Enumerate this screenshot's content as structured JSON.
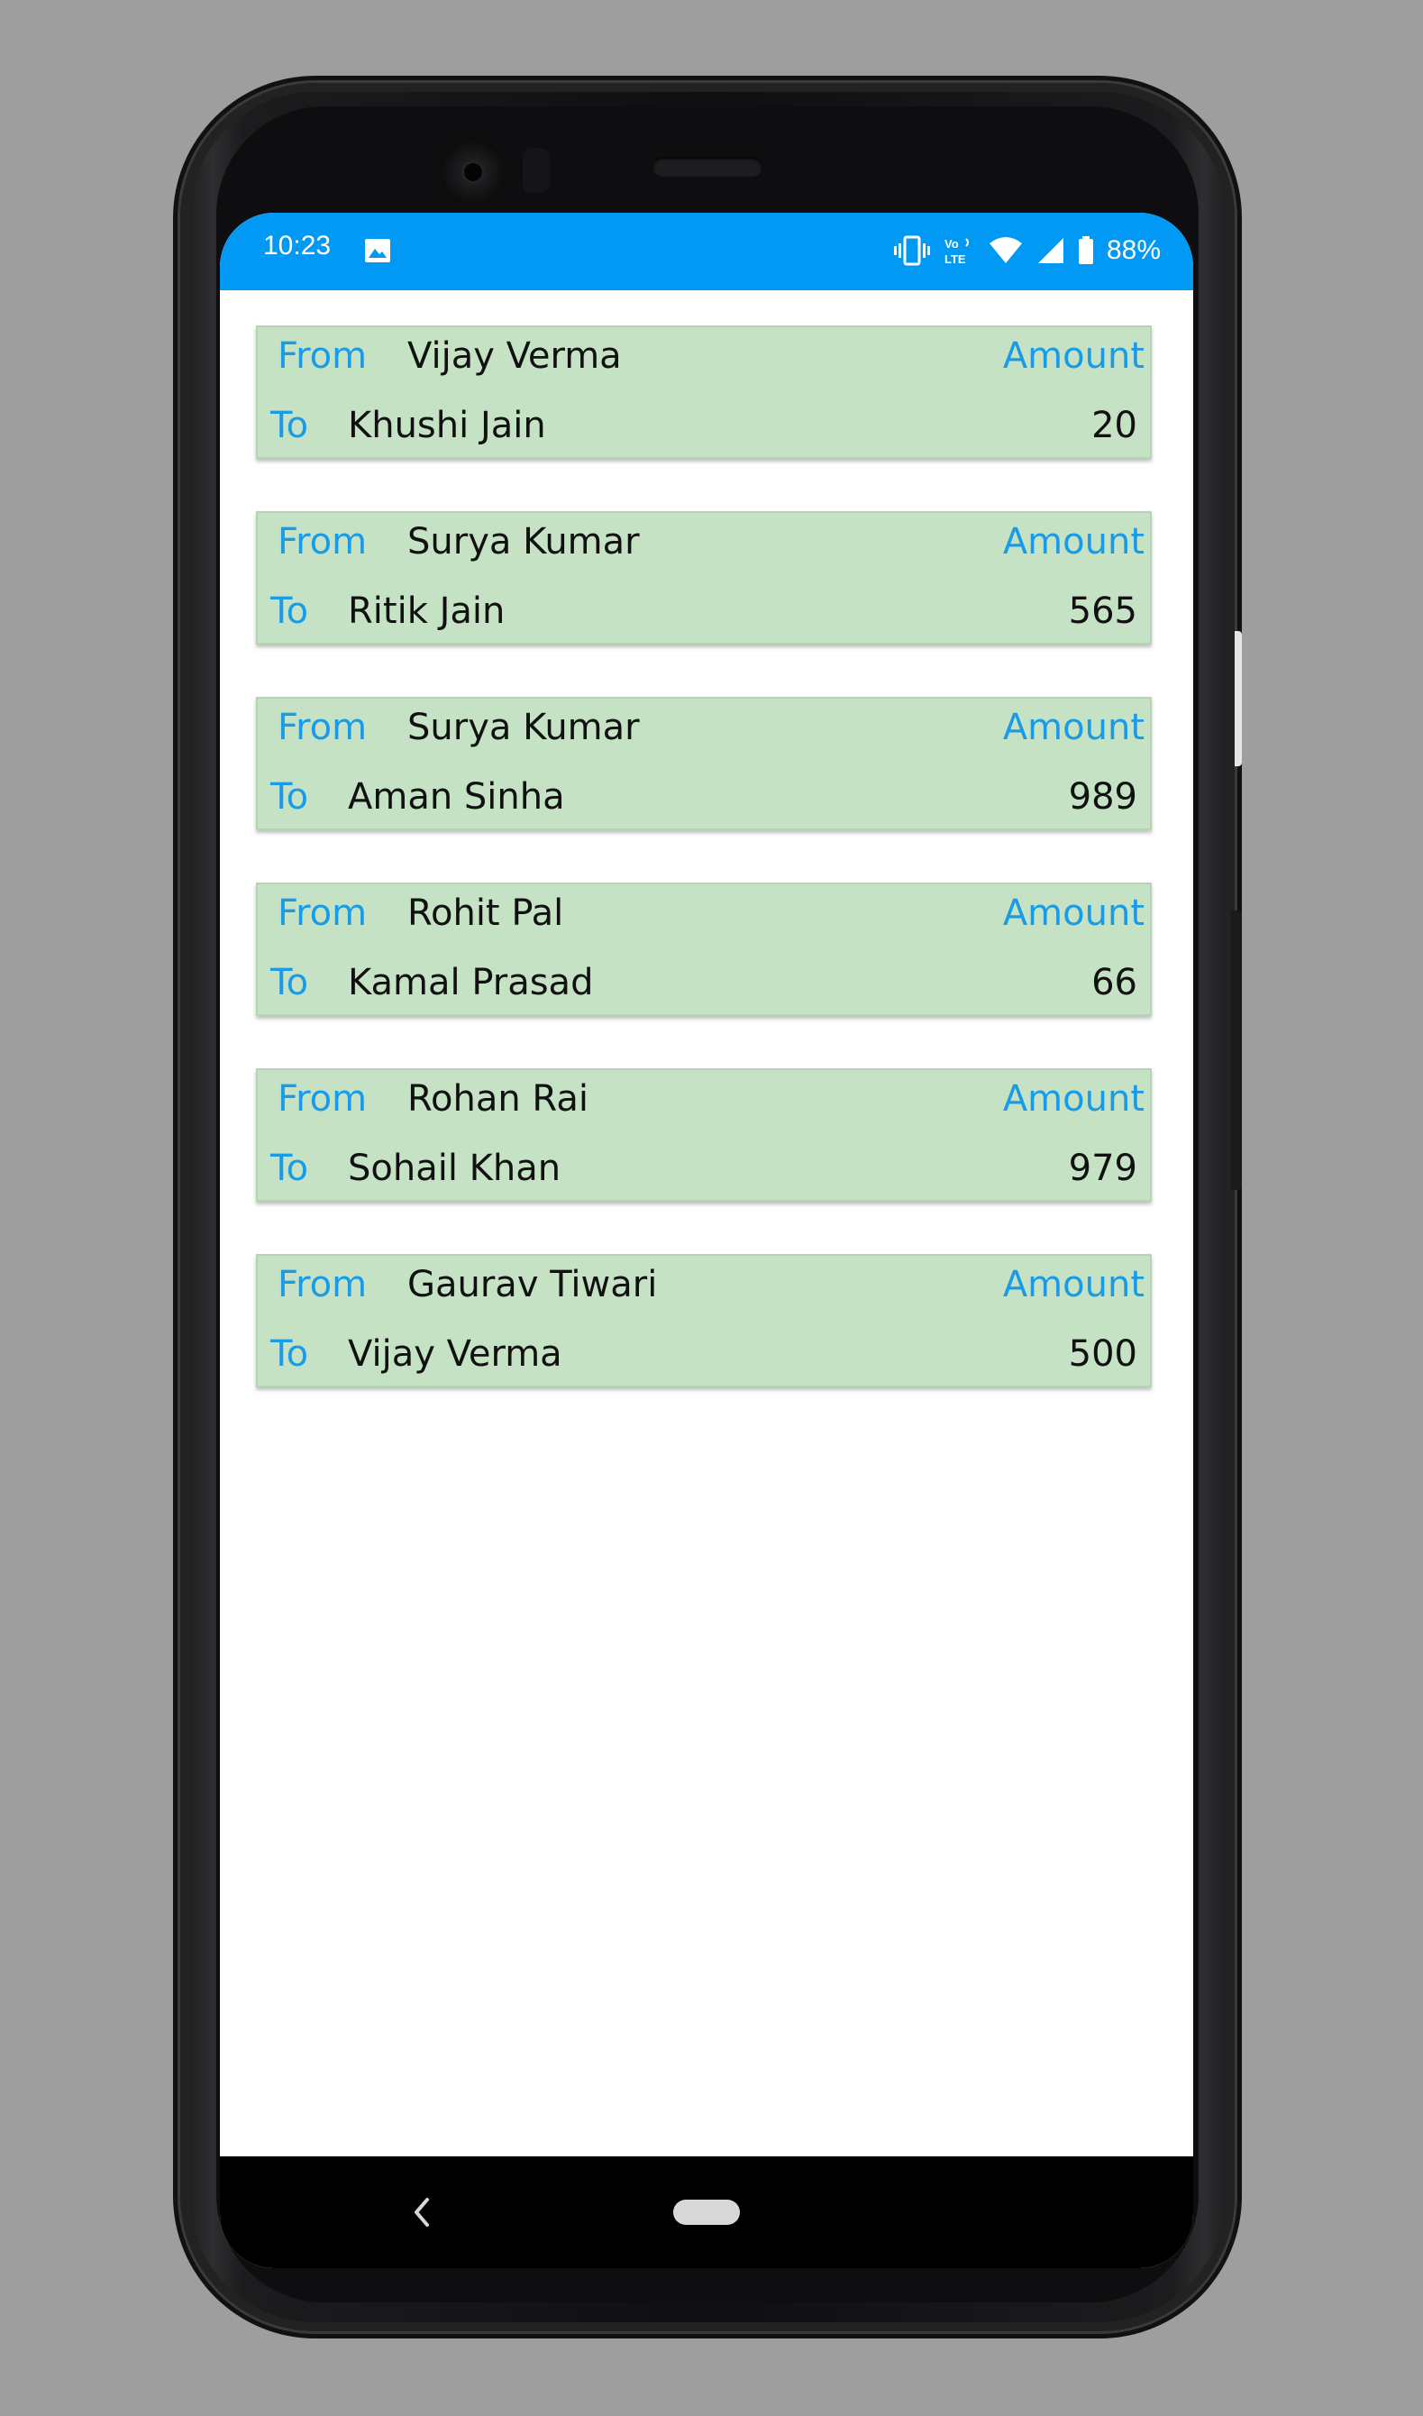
{
  "status_bar": {
    "time": "10:23",
    "battery": "88%",
    "icons": [
      "image-icon",
      "vibrate-icon",
      "volte-icon",
      "wifi-icon",
      "signal-icon",
      "battery-icon"
    ]
  },
  "labels": {
    "from": "From",
    "to": "To",
    "amount": "Amount"
  },
  "transactions": [
    {
      "from": "Vijay Verma",
      "to": "Khushi Jain",
      "amount": "20"
    },
    {
      "from": "Surya Kumar",
      "to": "Ritik Jain",
      "amount": "565"
    },
    {
      "from": "Surya Kumar",
      "to": "Aman Sinha",
      "amount": "989"
    },
    {
      "from": "Rohit Pal",
      "to": "Kamal Prasad",
      "amount": "66"
    },
    {
      "from": "Rohan Rai",
      "to": "Sohail Khan",
      "amount": "979"
    },
    {
      "from": "Gaurav Tiwari",
      "to": "Vijay Verma",
      "amount": "500"
    }
  ],
  "colors": {
    "status_bar": "#0299f5",
    "card_background": "#c5e3c4",
    "label_blue": "#1a9be8"
  }
}
